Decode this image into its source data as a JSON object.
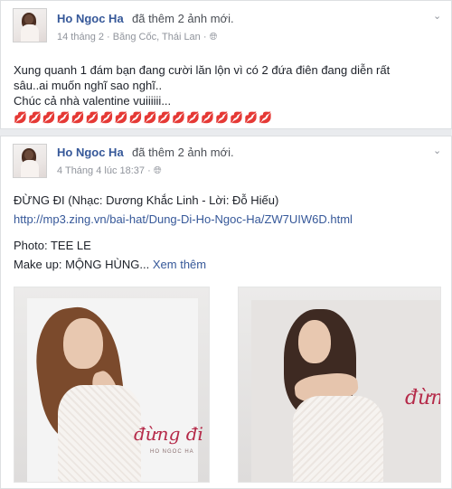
{
  "posts": [
    {
      "author": "Ho Ngoc Ha",
      "action": "đã thêm 2 ảnh mới.",
      "meta": "14 tháng 2 · Băng Cốc, Thái Lan · ",
      "lines": [
        "Xung quanh 1 đám bạn đang cười lăn lộn vì có 2 đứa điên đang diễn rất",
        "sâu..ai muốn nghĩ sao nghĩ..",
        "Chúc cả nhà valentine vuiiiiii..."
      ],
      "emoji_hearts": "💋💋💋💋💋💋💋💋💋💋💋💋💋💋💋💋💋💋"
    },
    {
      "author": "Ho Ngoc Ha",
      "action": "đã thêm 2 ảnh mới.",
      "meta": "4 Tháng 4 lúc 18:37 · ",
      "title": "ĐỪNG ĐI (Nhạc: Dương Khắc Linh - Lời: Đỗ Hiếu)",
      "link": "http://mp3.zing.vn/bai-hat/Dung-Di-Ho-Ngoc-Ha/ZW7UIW6D.html",
      "photo_credit": "Photo: TEE LE",
      "makeup": "Make up: MỘNG HÙNG... ",
      "see_more": "Xem thêm",
      "photo1_script": "đừng đi",
      "photo1_brand": "HO NGOC HA",
      "photo2_script": "đừn"
    }
  ],
  "icons": {
    "privacy": "globe-icon",
    "menu": "chevron-down-icon"
  }
}
